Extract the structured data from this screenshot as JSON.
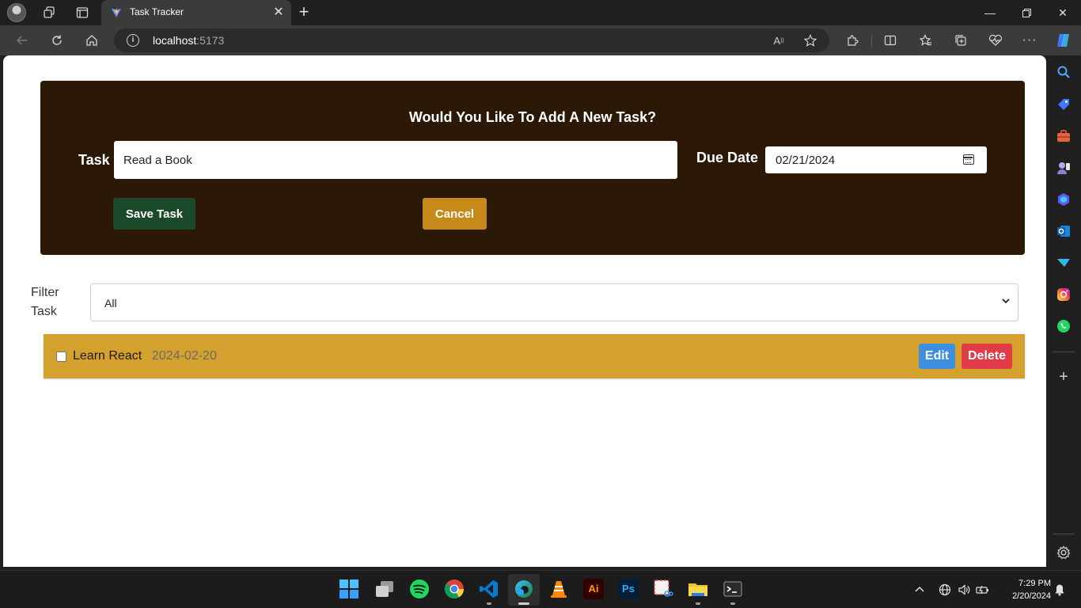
{
  "browser": {
    "tab_title": "Task Tracker",
    "address_host": "localhost",
    "address_port": ":5173"
  },
  "form": {
    "title": "Would You Like To Add A New Task?",
    "task_label": "Task",
    "task_value": "Read a Book",
    "due_label": "Due Date",
    "due_value": "02/21/2024",
    "save_label": "Save Task",
    "cancel_label": "Cancel"
  },
  "filter": {
    "label": "Filter Task",
    "selected": "All"
  },
  "tasks": [
    {
      "name": "Learn React",
      "date": "2024-02-20",
      "done": false,
      "edit_label": "Edit",
      "delete_label": "Delete"
    }
  ],
  "taskbar": {
    "time": "7:29 PM",
    "date": "2/20/2024"
  },
  "colors": {
    "form_bg": "#2b1806",
    "save": "#1b4a2b",
    "cancel": "#c68a1a",
    "task_row": "#d4a02e",
    "edit": "#3c8fe0",
    "delete": "#e23b48"
  }
}
